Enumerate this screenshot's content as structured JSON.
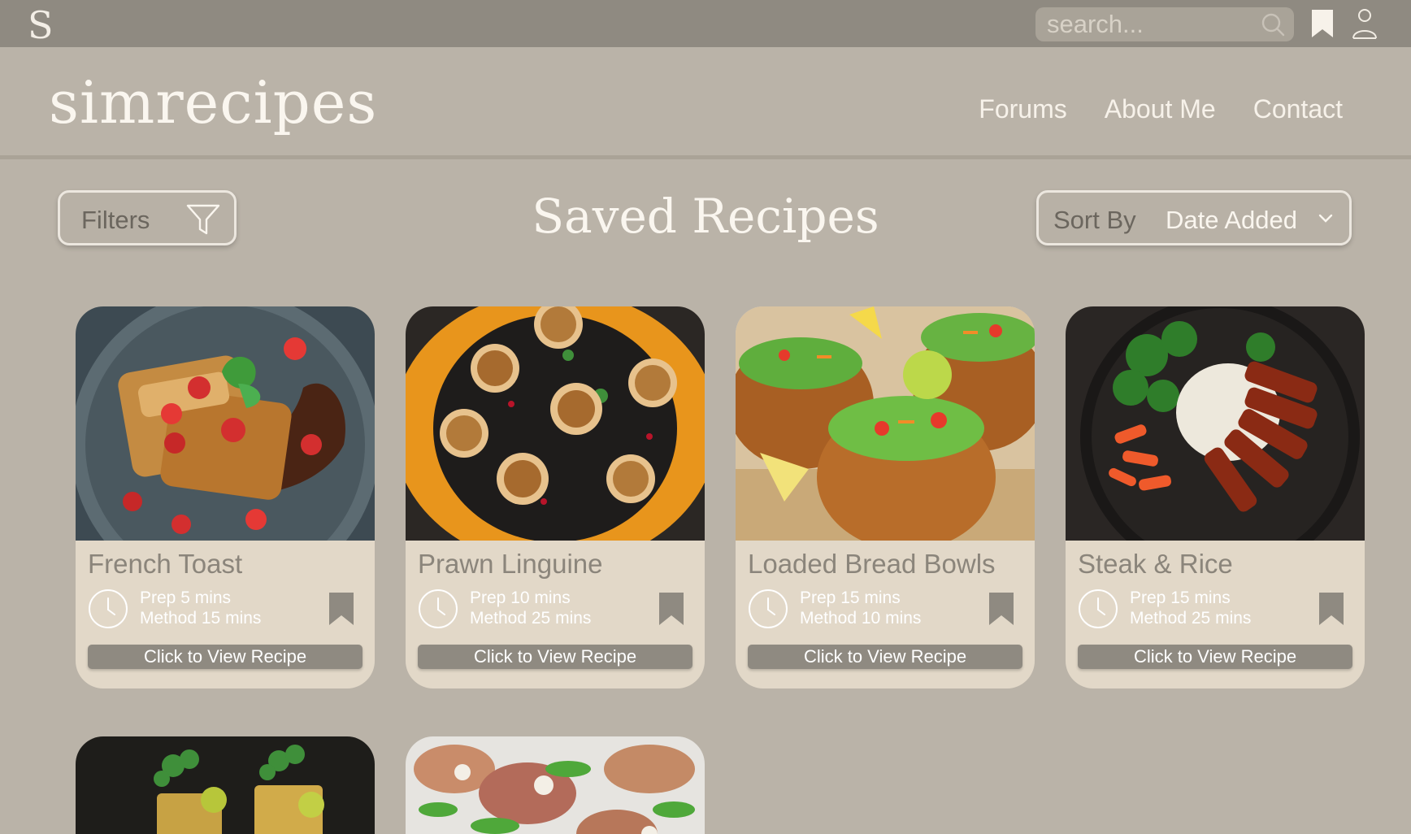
{
  "topbar": {
    "logo_letter": "S",
    "search_placeholder": "search...",
    "icons": [
      "search-icon",
      "bookmark-icon",
      "user-icon"
    ]
  },
  "header": {
    "brand": "simrecipes",
    "nav": [
      "Forums",
      "About Me",
      "Contact"
    ]
  },
  "toolbar": {
    "filters_label": "Filters",
    "title": "Saved Recipes",
    "sort_label": "Sort By",
    "sort_value": "Date Added"
  },
  "recipes": [
    {
      "title": "French Toast",
      "prep": "Prep 5 mins",
      "method": "Method 15 mins",
      "button": "Click to View Recipe"
    },
    {
      "title": "Prawn Linguine",
      "prep": "Prep 10 mins",
      "method": "Method 25 mins",
      "button": "Click to View Recipe"
    },
    {
      "title": "Loaded Bread Bowls",
      "prep": "Prep 15 mins",
      "method": "Method 10 mins",
      "button": "Click to View Recipe"
    },
    {
      "title": "Steak & Rice",
      "prep": "Prep 15 mins",
      "method": "Method 25 mins",
      "button": "Click to View Recipe"
    }
  ],
  "colors": {
    "topbar": "#8f8a81",
    "background": "#bab3a8",
    "card": "#e2d8c8",
    "button": "#8f8a81",
    "text_light": "#faf6ef"
  }
}
